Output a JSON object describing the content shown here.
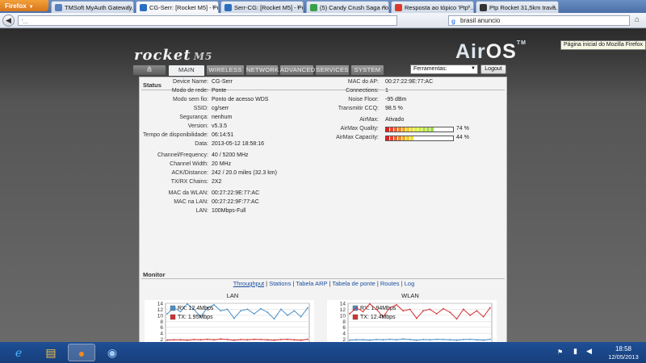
{
  "browser": {
    "menu_label": "Firefox",
    "tabs": [
      {
        "label": "TMSoft MyAuth Gateway...",
        "icon_color": "#5a7fc0"
      },
      {
        "label": "CG-Serr: [Rocket M5] - Pr...",
        "icon_color": "#2a6fbf"
      },
      {
        "label": "Serr-CG: [Rocket M5] - Pr...",
        "icon_color": "#2a6fbf"
      },
      {
        "label": "(5) Candy Crush Saga no ...",
        "icon_color": "#3aa04a"
      },
      {
        "label": "Resposta ao tópico 'Ptp ...",
        "icon_color": "#d93a2a"
      },
      {
        "label": "Ptp Rocket 31,5km trava...",
        "icon_color": "#333333"
      }
    ],
    "url_value": "'...",
    "search_value": "brasil anuncio",
    "tooltip": "Página inicial do Mozilla Firefox"
  },
  "header": {
    "rocket_logo": "rocket",
    "rocket_model": "M5",
    "airos_air": "Air",
    "airos_os": "OS",
    "airos_tm": "TM"
  },
  "nav": {
    "tabs": [
      "MAIN",
      "WIRELESS",
      "NETWORK",
      "ADVANCED",
      "SERVICES",
      "SYSTEM"
    ],
    "tools_label": "Ferramentas:",
    "logout_label": "Logout"
  },
  "status": {
    "title": "Status",
    "left": [
      {
        "label": "Device Name:",
        "value": "CG-Serr"
      },
      {
        "label": "Modo de rede:",
        "value": "Ponte"
      },
      {
        "label": "Modo sem fio:",
        "value": "Ponto de acesso WDS"
      },
      {
        "label": "SSID:",
        "value": "cg/serr"
      },
      {
        "label": "Segurança:",
        "value": "nenhum"
      },
      {
        "label": "Version:",
        "value": "v5.3.5"
      },
      {
        "label": "Tempo de disponibilidade:",
        "value": "06:14:51"
      },
      {
        "label": "Data:",
        "value": "2013-05-12 18:58:16"
      },
      {
        "label": "Channel/Frequency:",
        "value": "40 / 5200 MHz"
      },
      {
        "label": "Channel Width:",
        "value": "20 MHz"
      },
      {
        "label": "ACK/Distance:",
        "value": "242 / 20.0 miles (32.3 km)"
      },
      {
        "label": "TX/RX Chains:",
        "value": "2X2"
      },
      {
        "label": "MAC da WLAN:",
        "value": "00:27:22:9E:77:AC"
      },
      {
        "label": "MAC na LAN:",
        "value": "00:27:22:9F:77:AC"
      },
      {
        "label": "LAN:",
        "value": "100Mbps-Full"
      }
    ],
    "right": [
      {
        "label": "MAC do AP:",
        "value": "00:27:22:9E:77:AC"
      },
      {
        "label": "Connections:",
        "value": "1"
      },
      {
        "label": "Noise Floor:",
        "value": "-95 dBm"
      },
      {
        "label": "Transmitir CCQ:",
        "value": "98.5 %"
      },
      {
        "label": "AirMax:",
        "value": "Ativado"
      },
      {
        "label": "AirMax Quality:",
        "value": "74 %",
        "level": 0.74
      },
      {
        "label": "AirMax Capacity:",
        "value": "44 %",
        "level": 0.44
      }
    ]
  },
  "monitor": {
    "title": "Monitor",
    "links": [
      "Throughput",
      "Stations",
      "Tabela ARP",
      "Tabela de ponte",
      "Routes",
      "Log"
    ],
    "separator": " | "
  },
  "chart_data": [
    {
      "type": "line",
      "title": "LAN",
      "ylabel": "Mbps",
      "ylim": [
        0,
        14
      ],
      "yticks": [
        0,
        2,
        4,
        6,
        8,
        10,
        12,
        14
      ],
      "grid": true,
      "legend_position": "top-left",
      "series": [
        {
          "name": "RX: 12.4Mbps",
          "color": "#4a8fc8",
          "values": [
            10.5,
            12.5,
            11.2,
            13.8,
            12.0,
            9.5,
            12.5,
            13.5,
            11.5,
            12.0,
            9.0,
            11.5,
            12.0,
            10.5,
            12.2,
            11.0,
            8.8,
            12.0,
            10.0,
            11.5,
            9.5,
            12.5
          ]
        },
        {
          "name": "TX: 1.95Mbps",
          "color": "#d33030",
          "values": [
            1.7,
            1.8,
            1.8,
            1.7,
            1.9,
            1.8,
            2.0,
            1.8,
            2.1,
            1.9,
            1.7,
            1.9,
            1.8,
            2.0,
            1.9,
            1.8,
            1.7,
            1.9,
            2.0,
            1.8,
            1.7,
            2.0
          ]
        }
      ]
    },
    {
      "type": "line",
      "title": "WLAN",
      "ylabel": "Mbps",
      "ylim": [
        0,
        14
      ],
      "yticks": [
        0,
        2,
        4,
        6,
        8,
        10,
        12,
        14
      ],
      "grid": true,
      "legend_position": "top-left",
      "series": [
        {
          "name": "RX: 1.94Mbps",
          "color": "#4a8fc8",
          "values": [
            1.7,
            1.8,
            1.8,
            1.7,
            1.9,
            1.8,
            2.0,
            1.8,
            2.1,
            1.9,
            1.7,
            1.9,
            1.8,
            2.0,
            1.9,
            1.8,
            1.7,
            1.9,
            2.0,
            1.8,
            1.7,
            2.0
          ]
        },
        {
          "name": "TX: 12.4Mbps",
          "color": "#d33030",
          "values": [
            10.5,
            12.5,
            11.2,
            13.8,
            12.0,
            9.5,
            12.5,
            13.5,
            11.5,
            12.0,
            9.0,
            11.5,
            12.0,
            10.5,
            12.2,
            11.0,
            8.8,
            12.0,
            10.0,
            11.5,
            9.5,
            12.5
          ]
        }
      ]
    }
  ],
  "taskbar": {
    "icons": [
      "ie-icon",
      "explorer-icon",
      "firefox-icon",
      "thunderbird-icon"
    ],
    "time": "18:58",
    "date": "12/05/2013"
  }
}
